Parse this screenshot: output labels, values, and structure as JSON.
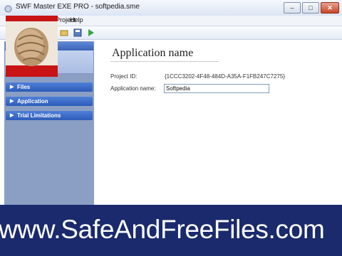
{
  "window": {
    "title": "SWF Master EXE PRO - softpedia.sme",
    "buttons": {
      "minimize": "–",
      "maximize": "□",
      "close": "✕"
    }
  },
  "menu": {
    "items": [
      "Project",
      "Help"
    ]
  },
  "toolbar": {
    "icons": [
      "open-icon",
      "save-icon",
      "play-icon"
    ]
  },
  "sidebar": {
    "items": [
      {
        "label": "Files"
      },
      {
        "label": "Application"
      },
      {
        "label": "Trial Limitations"
      }
    ]
  },
  "main": {
    "title": "Application name",
    "project_id_label": "Project ID:",
    "project_id_value": "{1CCC3202-4F48-484D-A35A-F1FB247C7275}",
    "app_name_label": "Application name:",
    "app_name_value": "Softpedia"
  },
  "watermark": {
    "text": "www.SafeAndFreeFiles.com"
  },
  "colors": {
    "sidebar_accent": "#2d5cb8",
    "watermark_bg": "#1a2a6c",
    "thumbnail_bg": "#c81414"
  }
}
